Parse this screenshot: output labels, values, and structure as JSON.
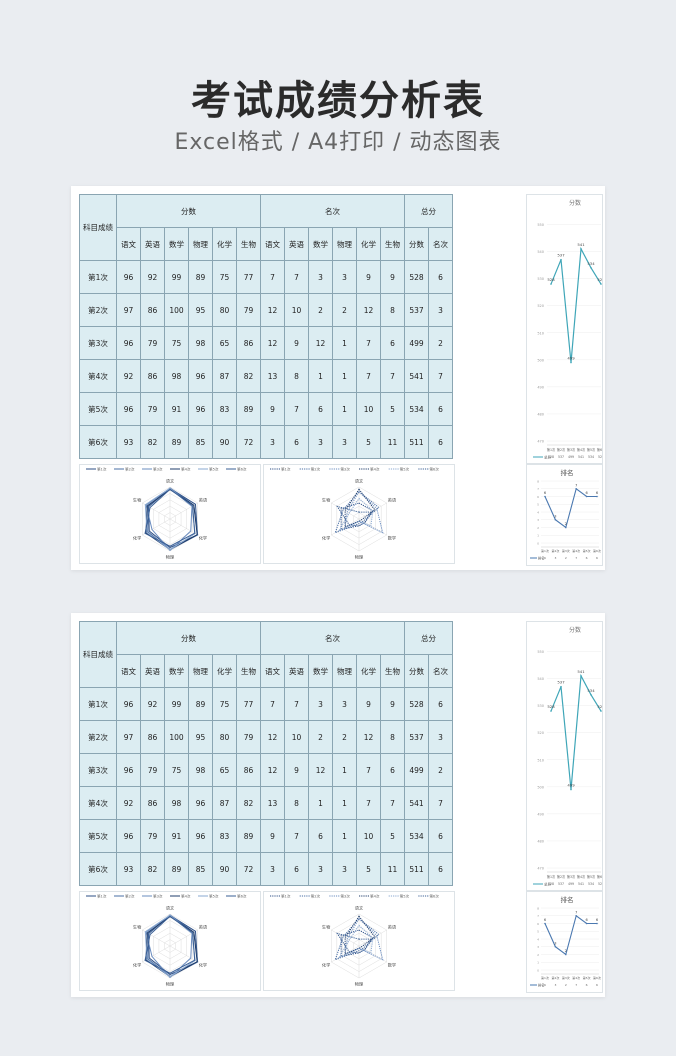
{
  "header": {
    "title": "考试成绩分析表",
    "subtitle": "Excel格式 / A4打印 / 动态图表"
  },
  "table": {
    "corner_label": "科目成绩",
    "group_scores": "分数",
    "group_ranks": "名次",
    "group_total": "总分",
    "subjects": [
      "语文",
      "英语",
      "数学",
      "物理",
      "化学",
      "生物"
    ],
    "total_cols": [
      "分数",
      "名次"
    ],
    "rows": [
      {
        "label": "第1次",
        "scores": [
          96,
          92,
          99,
          89,
          75,
          77
        ],
        "ranks": [
          7,
          7,
          3,
          3,
          9,
          9
        ],
        "total": 528,
        "total_rank": 6
      },
      {
        "label": "第2次",
        "scores": [
          97,
          86,
          100,
          95,
          80,
          79
        ],
        "ranks": [
          12,
          10,
          2,
          2,
          12,
          8
        ],
        "total": 537,
        "total_rank": 3
      },
      {
        "label": "第3次",
        "scores": [
          96,
          79,
          75,
          98,
          65,
          86
        ],
        "ranks": [
          12,
          9,
          12,
          1,
          7,
          6
        ],
        "total": 499,
        "total_rank": 2
      },
      {
        "label": "第4次",
        "scores": [
          92,
          86,
          98,
          96,
          87,
          82
        ],
        "ranks": [
          13,
          8,
          1,
          1,
          7,
          7
        ],
        "total": 541,
        "total_rank": 7
      },
      {
        "label": "第5次",
        "scores": [
          96,
          79,
          91,
          96,
          83,
          89
        ],
        "ranks": [
          9,
          7,
          6,
          1,
          10,
          5
        ],
        "total": 534,
        "total_rank": 6
      },
      {
        "label": "第6次",
        "scores": [
          93,
          82,
          89,
          85,
          90,
          72
        ],
        "ranks": [
          3,
          6,
          3,
          3,
          5,
          11
        ],
        "total": 511,
        "total_rank": 6
      }
    ]
  },
  "chart_data": [
    {
      "type": "line",
      "title": "分数",
      "categories": [
        "第1次",
        "第2次",
        "第3次",
        "第4次",
        "第5次",
        "第6次"
      ],
      "series": [
        {
          "name": "总分",
          "values": [
            528,
            537,
            499,
            541,
            534,
            528
          ]
        }
      ],
      "ylim": [
        470,
        555
      ],
      "yticks": [
        470,
        480,
        490,
        500,
        510,
        520,
        530,
        540,
        550
      ],
      "color": "#3fa6b8"
    },
    {
      "type": "line",
      "title": "排名",
      "categories": [
        "第1次",
        "第2次",
        "第3次",
        "第4次",
        "第5次",
        "第6次"
      ],
      "series": [
        {
          "name": "排名",
          "values": [
            6,
            3,
            2,
            7,
            6,
            6
          ]
        }
      ],
      "ylim": [
        0,
        8
      ],
      "color": "#4a78b0"
    },
    {
      "type": "radar",
      "axes": [
        "语文",
        "英语",
        "化学",
        "物理",
        "化学",
        "生物"
      ],
      "legend": [
        "第1次",
        "第2次",
        "第3次",
        "第4次",
        "第5次",
        "第6次"
      ],
      "range": [
        0,
        100
      ]
    },
    {
      "type": "radar",
      "axes": [
        "语文",
        "英语",
        "数学",
        "物理",
        "化学",
        "生物"
      ],
      "legend": [
        "第1次",
        "第2次",
        "第3次",
        "第4次",
        "第5次",
        "第6次"
      ],
      "range": [
        0,
        14
      ]
    }
  ]
}
